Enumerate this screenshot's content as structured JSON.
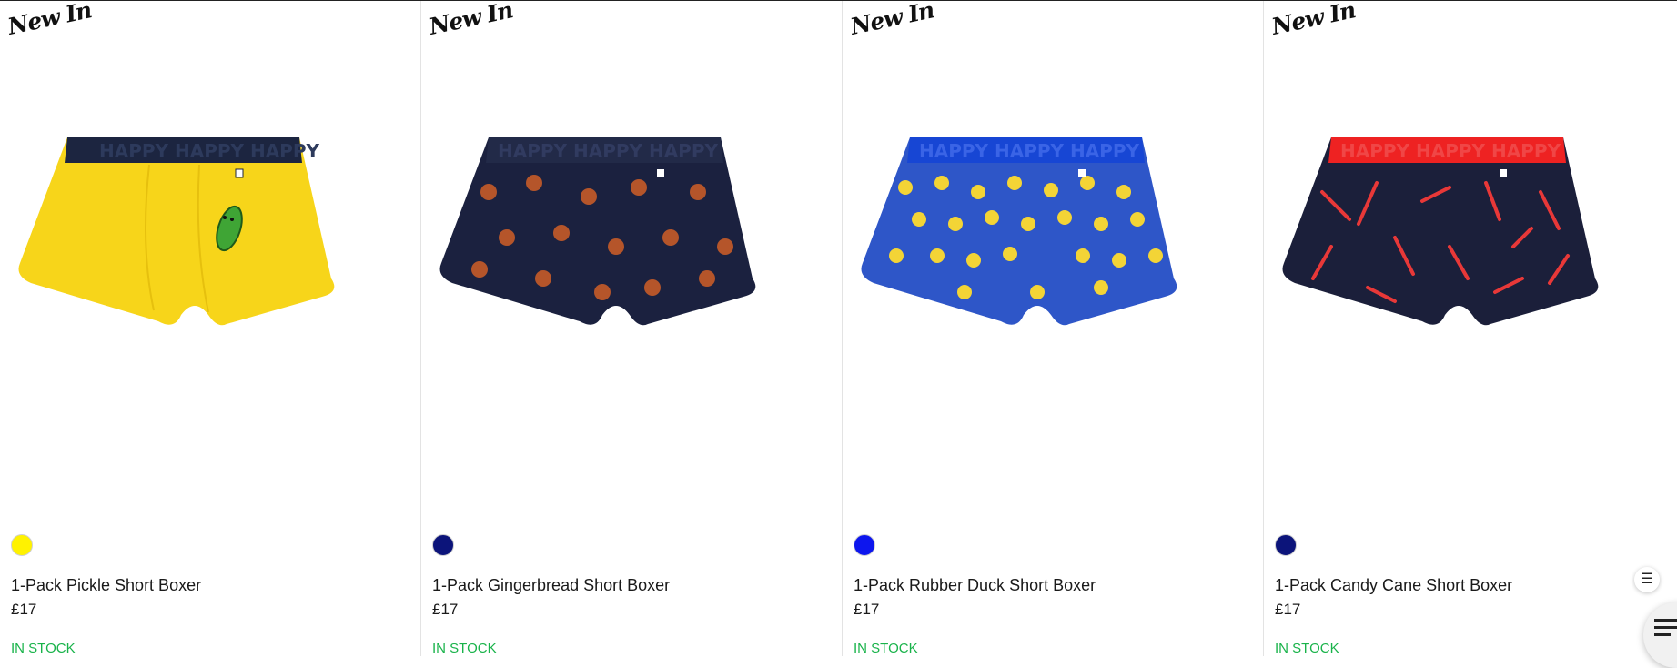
{
  "products": [
    {
      "badge": "New In",
      "name": "1-Pack Pickle Short Boxer",
      "price": "£17",
      "stock": "IN STOCK",
      "swatch_color": "#fff200",
      "image": "yellow-boxer-with-pickle-print"
    },
    {
      "badge": "New In",
      "name": "1-Pack Gingerbread Short Boxer",
      "price": "£17",
      "stock": "IN STOCK",
      "swatch_color": "#0c147a",
      "image": "navy-boxer-with-gingerbread-print"
    },
    {
      "badge": "New In",
      "name": "1-Pack Rubber Duck Short Boxer",
      "price": "£17",
      "stock": "IN STOCK",
      "swatch_color": "#0d16ee",
      "image": "blue-boxer-with-rubber-duck-print"
    },
    {
      "badge": "New In",
      "name": "1-Pack Candy Cane Short Boxer",
      "price": "£17",
      "stock": "IN STOCK",
      "swatch_color": "#0c147a",
      "image": "navy-boxer-with-candy-cane-print"
    }
  ],
  "colors": {
    "in_stock": "#19b34a"
  },
  "icons": {
    "menu_small": "list-icon",
    "menu_fab": "menu-icon"
  }
}
